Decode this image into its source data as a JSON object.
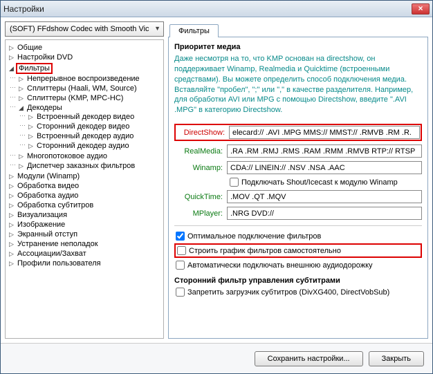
{
  "window": {
    "title": "Настройки"
  },
  "combo": {
    "value": "(SOFT) FFdshow Codec with Smooth Vic"
  },
  "tree": {
    "items": [
      {
        "label": "Общие"
      },
      {
        "label": "Настройки DVD"
      },
      {
        "label": "Фильтры",
        "highlight": true,
        "children": [
          {
            "label": "Непрерывное воспроизведение"
          },
          {
            "label": "Сплиттеры (Haali, WM, Source)"
          },
          {
            "label": "Сплиттеры (KMP, MPC-HC)"
          },
          {
            "label": "Декодеры",
            "children": [
              {
                "label": "Встроенный декодер видео"
              },
              {
                "label": "Сторонний декодер видео"
              },
              {
                "label": "Встроенный декодер аудио"
              },
              {
                "label": "Сторонний декодер аудио"
              }
            ]
          },
          {
            "label": "Многопотоковое аудио"
          },
          {
            "label": "Диспетчер заказных фильтров"
          }
        ]
      },
      {
        "label": "Модули (Winamp)"
      },
      {
        "label": "Обработка видео"
      },
      {
        "label": "Обработка аудио"
      },
      {
        "label": "Обработка субтитров"
      },
      {
        "label": "Визуализация"
      },
      {
        "label": "Изображение"
      },
      {
        "label": "Экранный отступ"
      },
      {
        "label": "Устранение неполадок"
      },
      {
        "label": "Ассоциации/Захват"
      },
      {
        "label": "Профили пользователя"
      }
    ]
  },
  "tabs": {
    "active": "Фильтры"
  },
  "media": {
    "group_title": "Приоритет медиа",
    "desc": "Даже несмотря на то, что KMP основан на directshow, он поддерживает Winamp, Realmedia и Quicktime (встроенными средствами). Вы можете определить способ подключения медиа. Вставляйте \"пробел\", \";\" или \",\" в качестве разделителя. Например, для обработки AVI или MPG с помощью Directshow, введите \".AVI .MPG\" в категорию Directshow.",
    "rows": {
      "directshow": {
        "label": "DirectShow:",
        "value": "elecard:// .AVI .MPG MMS:// MMST:// .RMVB .RM .R."
      },
      "realmedia": {
        "label": "RealMedia:",
        "value": ".RA .RM .RMJ .RMS .RAM .RMM .RMVB RTP:// RTSP"
      },
      "winamp": {
        "label": "Winamp:",
        "value": "CDA:// LINEIN:// .NSV .NSA .AAC"
      },
      "quicktime": {
        "label": "QuickTime:",
        "value": ".MOV .QT .MQV"
      },
      "mplayer": {
        "label": "MPlayer:",
        "value": ".NRG DVD://"
      }
    },
    "shout_icecast": "Подключать Shout/Icecast к модулю Winamp",
    "opt": {
      "optimal": {
        "label": "Оптимальное подключение фильтров",
        "checked": true
      },
      "build_self": {
        "label": "Строить график фильтров самостоятельно",
        "checked": false
      },
      "auto_ext_audio": {
        "label": "Автоматически подключать внешнюю аудиодорожку",
        "checked": false
      }
    }
  },
  "sub": {
    "group_title": "Сторонний фильтр управления субтитрами",
    "deny": {
      "label": "Запретить загрузчик субтитров (DivXG400, DirectVobSub)",
      "checked": false
    }
  },
  "footer": {
    "save": "Сохранить настройки...",
    "close": "Закрыть"
  }
}
